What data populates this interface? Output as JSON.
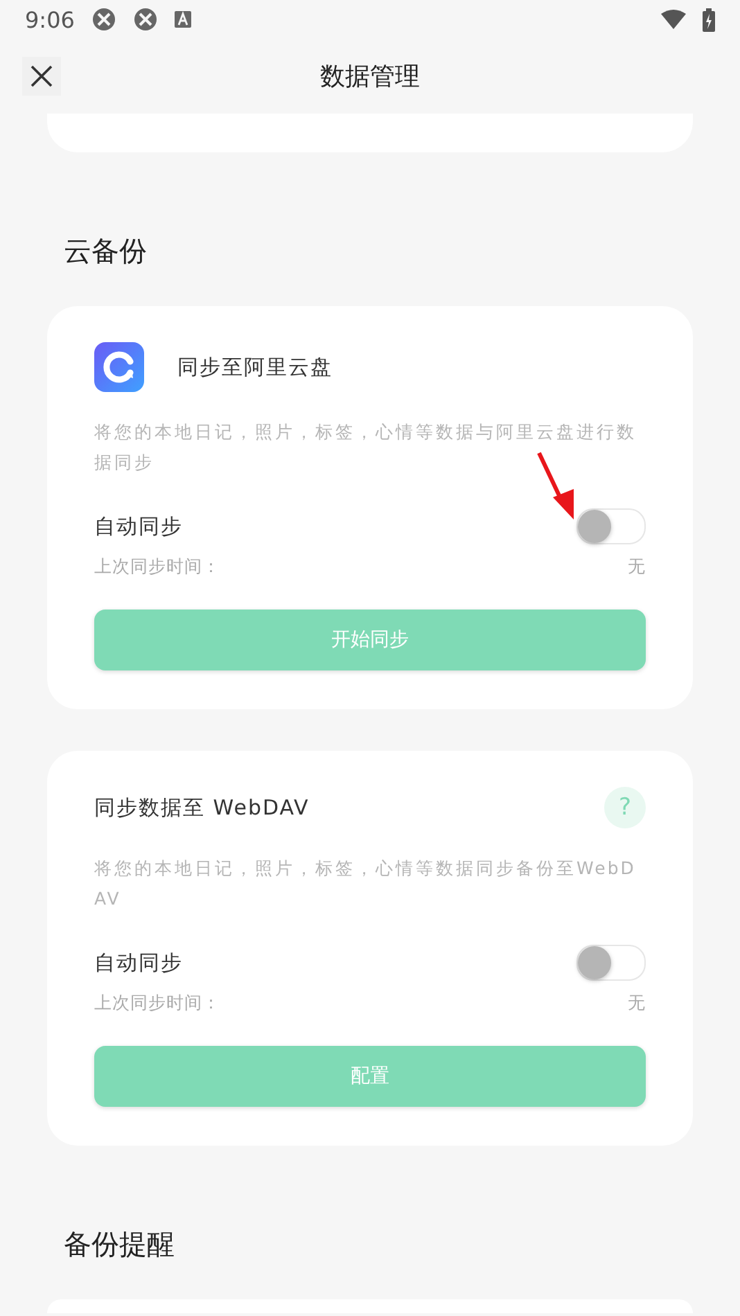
{
  "status_bar": {
    "time": "9:06"
  },
  "header": {
    "title": "数据管理"
  },
  "sections": [
    {
      "title": "云备份",
      "cards": [
        {
          "kind": "aliyun",
          "title": "同步至阿里云盘",
          "description": "将您的本地日记，照片，标签，心情等数据与阿里云盘进行数据同步",
          "auto_sync_label": "自动同步",
          "auto_sync_on": false,
          "last_sync_label": "上次同步时间：",
          "last_sync_value": "无",
          "button": "开始同步",
          "annotated": true
        },
        {
          "kind": "webdav",
          "title": "同步数据至 WebDAV",
          "help": "?",
          "description": "将您的本地日记，照片，标签，心情等数据同步备份至WebDAV",
          "auto_sync_label": "自动同步",
          "auto_sync_on": false,
          "last_sync_label": "上次同步时间：",
          "last_sync_value": "无",
          "button": "配置",
          "annotated": false
        }
      ]
    },
    {
      "title": "备份提醒"
    }
  ]
}
